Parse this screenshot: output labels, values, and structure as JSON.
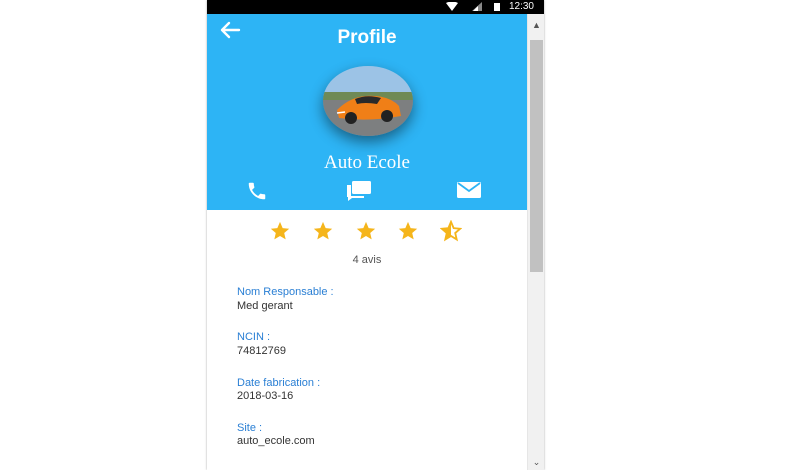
{
  "status_bar": {
    "time": "12:30"
  },
  "header": {
    "title": "Profile",
    "name": "Auto Ecole"
  },
  "actions": {
    "phone_icon": "phone-icon",
    "chat_icon": "chat-icon",
    "mail_icon": "mail-icon"
  },
  "rating": {
    "value": 4.5,
    "max": 5,
    "reviews_label": "4 avis"
  },
  "fields": [
    {
      "label": "Nom Responsable :",
      "value": "Med gerant"
    },
    {
      "label": "NCIN :",
      "value": "74812769"
    },
    {
      "label": "Date fabrication :",
      "value": "2018-03-16"
    },
    {
      "label": "Site :",
      "value": "auto_ecole.com"
    }
  ],
  "colors": {
    "header_bg": "#2db4f5",
    "star": "#f5b51b",
    "label": "#2a7fd4"
  }
}
